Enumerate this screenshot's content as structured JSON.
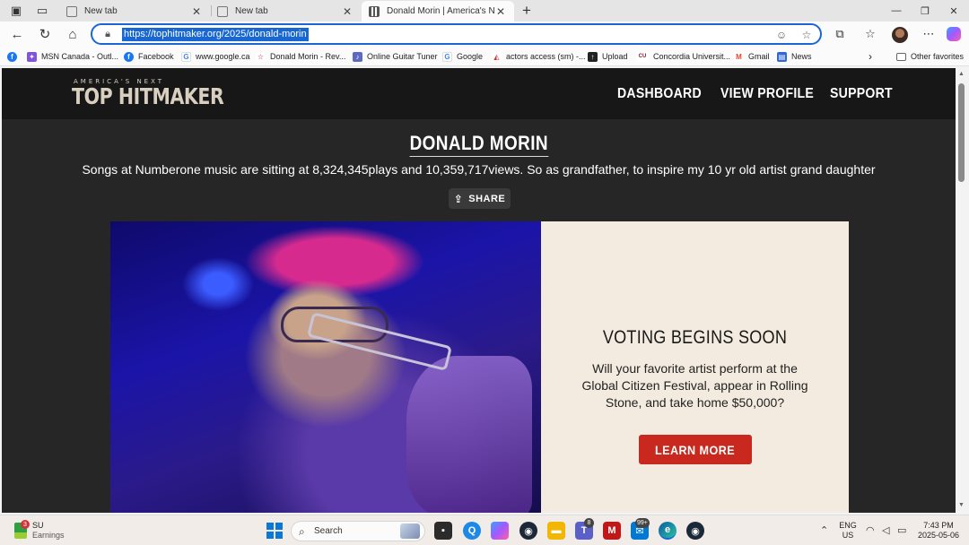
{
  "browser": {
    "tabs": [
      {
        "title": "New tab",
        "active": false
      },
      {
        "title": "New tab",
        "active": false
      },
      {
        "title": "Donald Morin | America's Next To",
        "active": true
      }
    ],
    "url": "https://tophitmaker.org/2025/donald-morin",
    "bookmarks": [
      {
        "label": "",
        "icon": "facebook-icon",
        "color": "#1877f2"
      },
      {
        "label": "MSN Canada - Outl...",
        "icon": "msn-icon",
        "color": "#7f56d9"
      },
      {
        "label": "Facebook",
        "icon": "facebook-icon",
        "color": "#1877f2"
      },
      {
        "label": "www.google.ca",
        "icon": "google-icon",
        "color": "#4285f4"
      },
      {
        "label": "Donald Morin - Rev...",
        "icon": "star-icon",
        "color": "#c2185b"
      },
      {
        "label": "Online Guitar Tuner",
        "icon": "tuner-icon",
        "color": "#5c6bc0"
      },
      {
        "label": "Google",
        "icon": "google-icon",
        "color": "#4285f4"
      },
      {
        "label": "actors access (sm) -...",
        "icon": "actors-access-icon",
        "color": "#d32f2f"
      },
      {
        "label": "Upload",
        "icon": "upload-icon",
        "color": "#222222"
      },
      {
        "label": "Concordia Universit...",
        "icon": "concordia-icon",
        "color": "#8b1a2b"
      },
      {
        "label": "Gmail",
        "icon": "gmail-icon",
        "color": "#ea4335"
      },
      {
        "label": "News",
        "icon": "news-icon",
        "color": "#3367d6"
      }
    ],
    "other_favorites": "Other favorites"
  },
  "site": {
    "logo_top": "AMERICA'S NEXT",
    "logo_main": "TOP HITMAKER",
    "nav": [
      "DASHBOARD",
      "VIEW PROFILE",
      "SUPPORT"
    ],
    "artist_name": "DONALD MORIN",
    "bio": "Songs at Numberone music are sitting at 8,324,345plays and 10,359,717views. So as grandfather, to inspire my 10 yr old artist grand daughter",
    "share_label": "SHARE",
    "promo": {
      "title": "VOTING BEGINS SOON",
      "text": "Will your favorite artist perform at the Global Citizen Festival, appear in Rolling Stone, and take home $50,000?",
      "button": "LEARN MORE"
    }
  },
  "taskbar": {
    "weather_title": "SU",
    "weather_sub": "Earnings",
    "weather_badge": "3",
    "search_placeholder": "Search",
    "teams_badge": "8",
    "mail_badge": "99+",
    "lang_line1": "ENG",
    "lang_line2": "US",
    "time": "7:43 PM",
    "date": "2025-05-06"
  },
  "colors": {
    "accent_blue": "#1967d2",
    "site_header": "#171717",
    "site_body": "#262626",
    "promo_bg": "#f3ebdf",
    "cta_red": "#c8281e"
  }
}
